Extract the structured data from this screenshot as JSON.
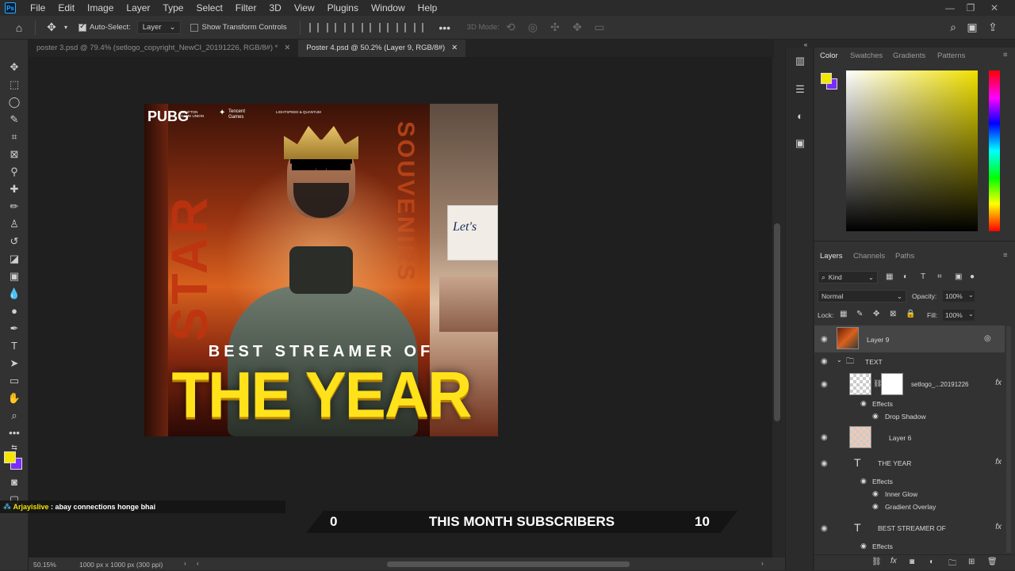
{
  "app": {
    "logo_text": "Ps"
  },
  "menu": [
    "File",
    "Edit",
    "Image",
    "Layer",
    "Type",
    "Select",
    "Filter",
    "3D",
    "View",
    "Plugins",
    "Window",
    "Help"
  ],
  "options_bar": {
    "auto_select_label": "Auto-Select:",
    "auto_select_target": "Layer",
    "show_transform_label": "Show Transform Controls",
    "mode_3d_label": "3D Mode:"
  },
  "tabs": [
    {
      "label": "poster 3.psd @ 79.4% (setlogo_copyright_NewCI_20191226, RGB/8#) *",
      "active": false
    },
    {
      "label": "Poster 4.psd @ 50.2% (Layer 9, RGB/8#)",
      "active": true
    }
  ],
  "poster": {
    "brand": "PUBG",
    "brand_sub": "KRAFTON GAME UNION",
    "tencent": "Tencent Games",
    "lightspeed": "LIGHTSPEED & QUANTUM",
    "vertical_left": "STAR",
    "vertical_right": "SOUVENIRS",
    "sign_text": "Let's",
    "headline_top": "BEST STREAMER OF",
    "headline_main": "THE YEAR"
  },
  "color_panel": {
    "tabs": [
      "Color",
      "Swatches",
      "Gradients",
      "Patterns"
    ],
    "foreground": "#f5e600",
    "background": "#7b2cff",
    "picker_hue": "#ffe600"
  },
  "layers_panel": {
    "tabs": [
      "Layers",
      "Channels",
      "Paths"
    ],
    "filter_kind": "Kind",
    "blend_mode": "Normal",
    "opacity_label": "Opacity:",
    "opacity_value": "100%",
    "lock_label": "Lock:",
    "fill_label": "Fill:",
    "fill_value": "100%",
    "layers": [
      {
        "name": "Layer 9",
        "type": "pixel",
        "selected": true
      },
      {
        "name": "TEXT",
        "type": "group"
      },
      {
        "name": "setlogo_...20191226",
        "type": "smart",
        "fx": "fx"
      },
      {
        "name": "Effects",
        "type": "effects"
      },
      {
        "name": "Drop Shadow",
        "type": "effect"
      },
      {
        "name": "Layer 6",
        "type": "pixel"
      },
      {
        "name": "THE YEAR",
        "type": "text",
        "fx": "fx"
      },
      {
        "name": "Effects",
        "type": "effects"
      },
      {
        "name": "Inner Glow",
        "type": "effect"
      },
      {
        "name": "Gradient Overlay",
        "type": "effect"
      },
      {
        "name": "BEST STREAMER  OF",
        "type": "text",
        "fx": "fx"
      },
      {
        "name": "Effects",
        "type": "effects"
      }
    ],
    "bottom_icons": [
      "link-icon",
      "fx-icon",
      "mask-icon",
      "adjustment-icon",
      "folder-icon",
      "new-layer-icon",
      "trash-icon"
    ]
  },
  "status": {
    "zoom": "50.15%",
    "doc_info": "1000 px x 1000 px (300 ppi)"
  },
  "stream_overlay": {
    "chat_user": "Arjayislive",
    "chat_message": " : abay connections honge bhai",
    "banner_left": "0",
    "banner_title": "THIS MONTH SUBSCRIBERS",
    "banner_right": "10"
  }
}
